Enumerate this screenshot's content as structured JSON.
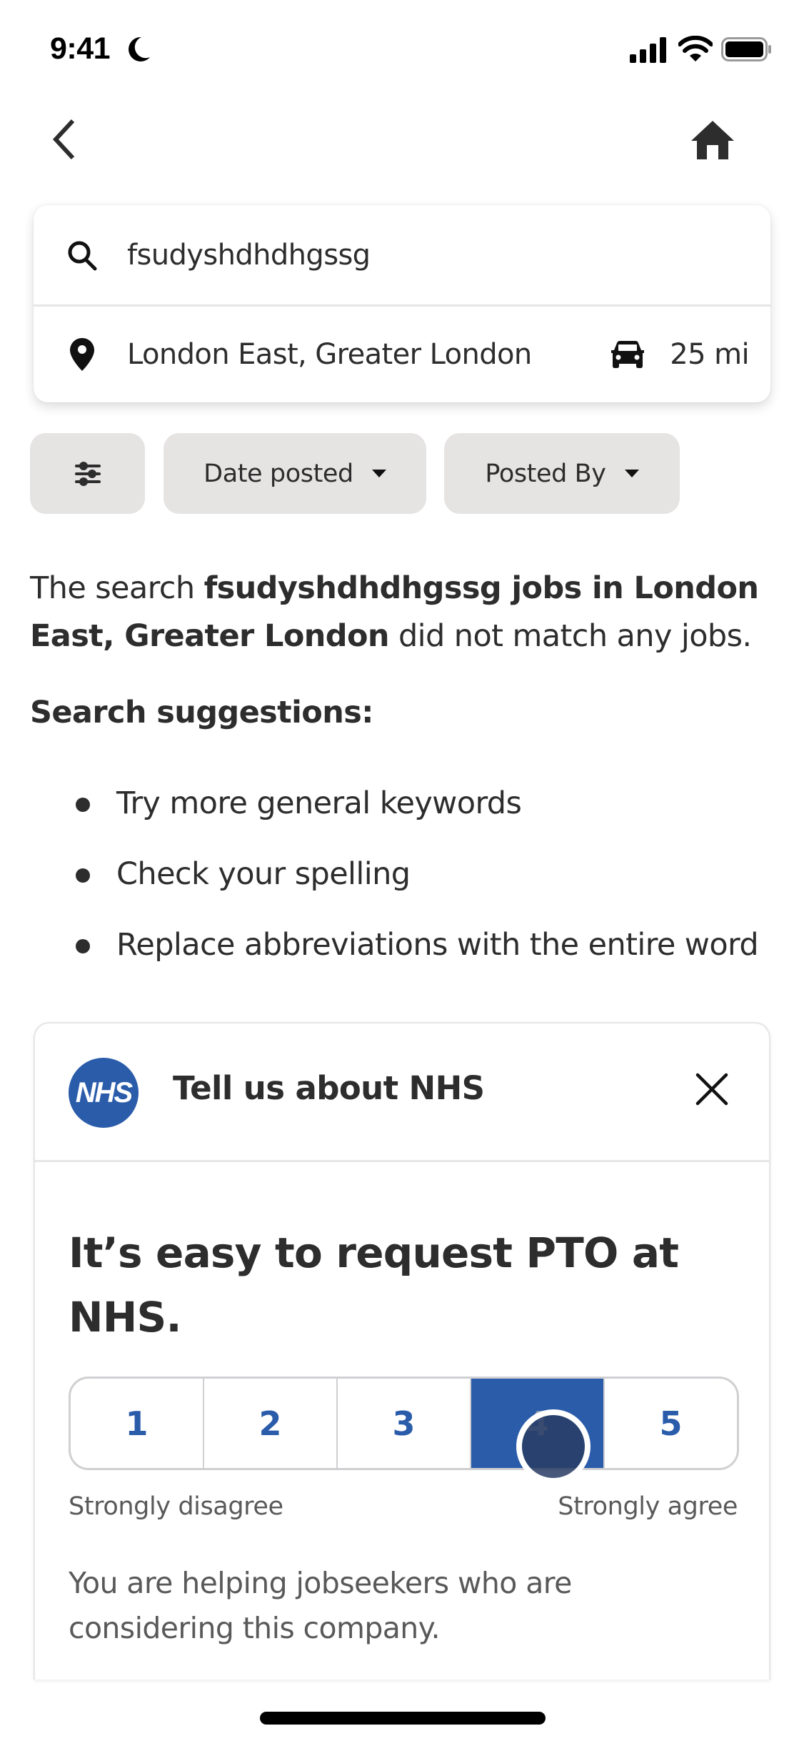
{
  "status_bar": {
    "time": "9:41",
    "icons": [
      "moon-icon",
      "signal-icon",
      "wifi-icon",
      "battery-icon"
    ]
  },
  "nav": {
    "back_icon": "chevron-left-icon",
    "home_icon": "home-icon"
  },
  "search": {
    "query": "fsudyshdhdhgssg",
    "location": "London East, Greater London",
    "radius": "25 mi",
    "icons": {
      "query": "search-icon",
      "location": "location-pin-icon",
      "radius": "car-icon"
    }
  },
  "filters": {
    "filter_icon": "sliders-icon",
    "chips": [
      {
        "label": "Date posted"
      },
      {
        "label": "Posted By"
      }
    ]
  },
  "results": {
    "message_prefix": "The search ",
    "message_bold": "fsudyshdhdhgssg jobs in London East, Greater London",
    "message_suffix": " did not match any jobs.",
    "suggestions_title": "Search suggestions:",
    "suggestions": [
      "Try more general keywords",
      "Check your spelling",
      "Replace abbreviations with the entire word"
    ]
  },
  "survey": {
    "logo_text": "NHS",
    "title": "Tell us about NHS",
    "question": "It’s easy to request PTO at NHS.",
    "options": [
      "1",
      "2",
      "3",
      "4",
      "5"
    ],
    "selected_value": 4,
    "scale_min_label": "Strongly disagree",
    "scale_max_label": "Strongly agree",
    "helper_text": "You are helping jobseekers who are considering this company.",
    "colors": {
      "accent": "#2a5caa"
    }
  }
}
